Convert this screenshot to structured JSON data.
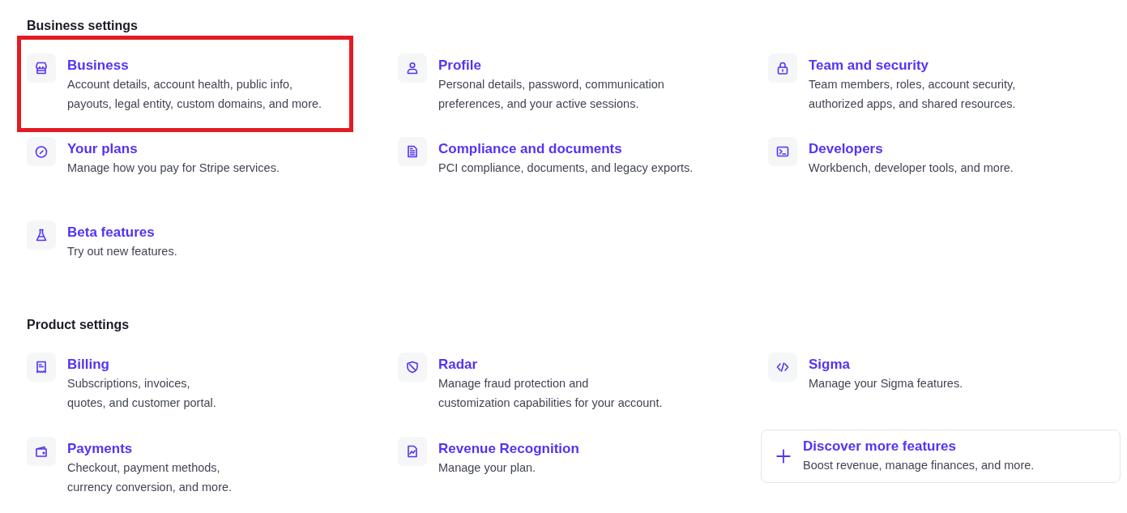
{
  "sections": [
    {
      "title": "Business settings",
      "items": [
        {
          "kind": "link",
          "title": "Business",
          "description": "Account details, account health, public info,\npayouts, legal entity, custom domains, and more.",
          "highlighted": true
        },
        {
          "kind": "link",
          "title": "Profile",
          "description": "Personal details, password, communication\npreferences, and your active sessions.",
          "highlighted": false
        },
        {
          "kind": "link",
          "title": "Team and security",
          "description": "Team members, roles, account security,\nauthorized apps, and shared resources.",
          "highlighted": false
        },
        {
          "kind": "link",
          "title": "Your plans",
          "description": "Manage how you pay for Stripe services.",
          "highlighted": false
        },
        {
          "kind": "link",
          "title": "Compliance and documents",
          "description": "PCI compliance, documents, and legacy exports.",
          "highlighted": false
        },
        {
          "kind": "link",
          "title": "Developers",
          "description": "Workbench, developer tools, and more.",
          "highlighted": false
        },
        {
          "kind": "link",
          "title": "Beta features",
          "description": "Try out new features.",
          "highlighted": false
        }
      ]
    },
    {
      "title": "Product settings",
      "items": [
        {
          "kind": "link",
          "title": "Billing",
          "description": "Subscriptions, invoices,\nquotes, and customer portal.",
          "highlighted": false
        },
        {
          "kind": "link",
          "title": "Radar",
          "description": "Manage fraud protection and\ncustomization capabilities for your account.",
          "highlighted": false
        },
        {
          "kind": "link",
          "title": "Sigma",
          "description": "Manage your Sigma features.",
          "highlighted": false
        },
        {
          "kind": "link",
          "title": "Payments",
          "description": "Checkout, payment methods,\ncurrency conversion, and more.",
          "highlighted": false
        },
        {
          "kind": "link",
          "title": "Revenue Recognition",
          "description": "Manage your plan.",
          "highlighted": false
        },
        {
          "kind": "card",
          "title": "Discover more features",
          "description": "Boost revenue, manage finances, and more.",
          "highlighted": false
        }
      ]
    }
  ]
}
